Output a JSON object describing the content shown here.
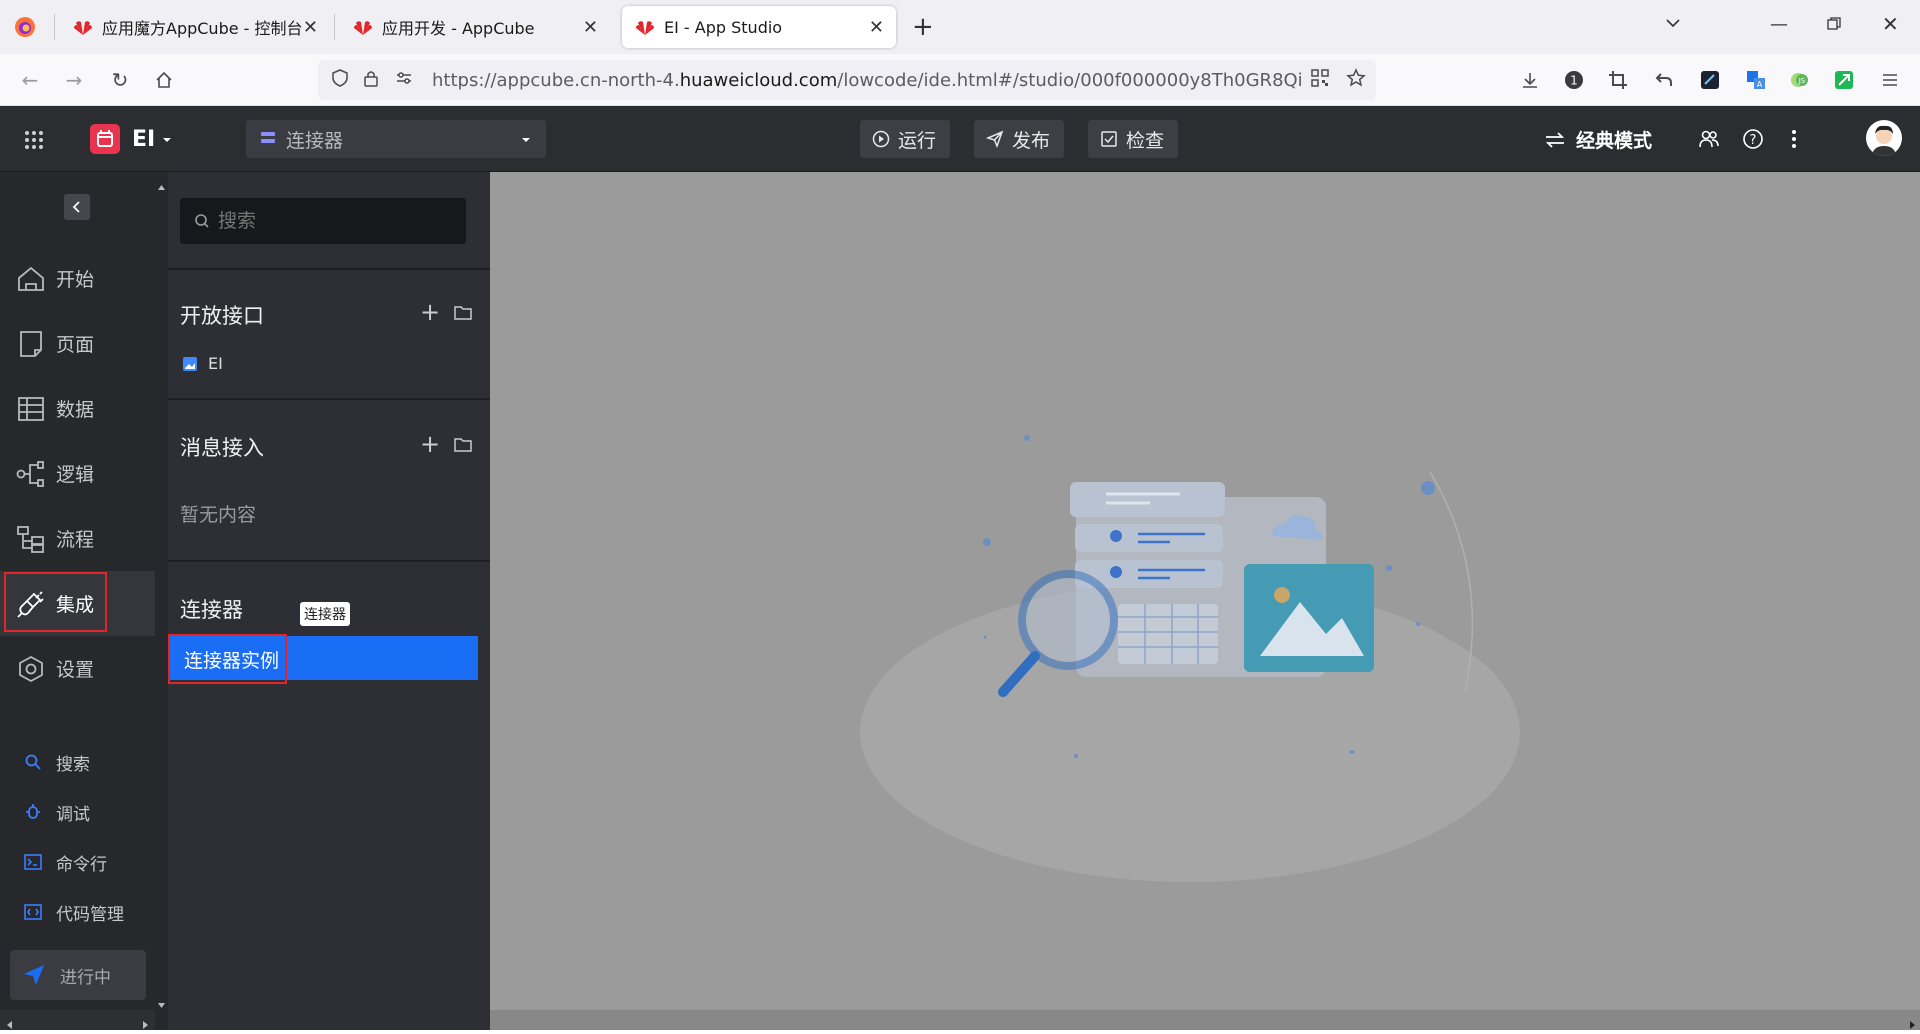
{
  "browser": {
    "tabs": [
      {
        "title": "应用魔方AppCube - 控制台",
        "active": false
      },
      {
        "title": "应用开发 - AppCube",
        "active": false
      },
      {
        "title": "EI - App Studio",
        "active": true
      }
    ],
    "url_prefix": "https://appcube.cn-north-4.",
    "url_domain": "huaweicloud.com",
    "url_suffix": "/lowcode/ide.html#/studio/000f000000y8Th0GR8Qi"
  },
  "header": {
    "app_name": "EI",
    "selector_value": "连接器",
    "run_label": "运行",
    "publish_label": "发布",
    "check_label": "检查",
    "mode_label": "经典模式"
  },
  "rail": {
    "items": [
      {
        "label": "开始",
        "icon": "home-icon"
      },
      {
        "label": "页面",
        "icon": "page-icon"
      },
      {
        "label": "数据",
        "icon": "table-icon"
      },
      {
        "label": "逻辑",
        "icon": "logic-icon"
      },
      {
        "label": "流程",
        "icon": "flow-icon"
      },
      {
        "label": "集成",
        "icon": "plug-icon",
        "active": true
      },
      {
        "label": "设置",
        "icon": "gear-icon"
      }
    ],
    "tools": [
      {
        "label": "搜索",
        "icon": "search-icon"
      },
      {
        "label": "调试",
        "icon": "bug-icon"
      },
      {
        "label": "命令行",
        "icon": "terminal-icon"
      },
      {
        "label": "代码管理",
        "icon": "code-icon"
      }
    ],
    "progress_label": "进行中"
  },
  "panel": {
    "search_placeholder": "搜索",
    "open_api": {
      "title": "开放接口",
      "items": [
        "EI"
      ]
    },
    "message": {
      "title": "消息接入",
      "empty_text": "暂无内容"
    },
    "connector": {
      "title": "连接器",
      "tooltip": "连接器",
      "items": [
        "连接器实例"
      ]
    }
  },
  "colors": {
    "accent": "#1a6ef5",
    "highlight_box": "#e0262b",
    "app_logo": "#e8344e"
  }
}
